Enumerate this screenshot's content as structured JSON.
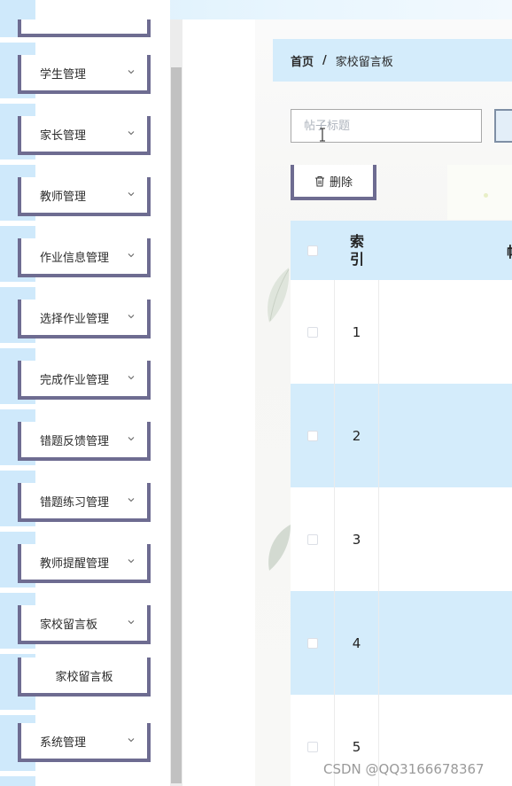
{
  "sidebar": {
    "items": [
      {
        "label": "学生管理"
      },
      {
        "label": "家长管理"
      },
      {
        "label": "教师管理"
      },
      {
        "label": "作业信息管理"
      },
      {
        "label": "选择作业管理"
      },
      {
        "label": "完成作业管理"
      },
      {
        "label": "错题反馈管理"
      },
      {
        "label": "错题练习管理"
      },
      {
        "label": "教师提醒管理"
      },
      {
        "label": "家校留言板"
      },
      {
        "label": "家校留言板"
      },
      {
        "label": "系统管理"
      }
    ]
  },
  "breadcrumb": {
    "home": "首页",
    "separator": "/",
    "current": "家校留言板"
  },
  "search": {
    "placeholder": "帖子标题",
    "value": ""
  },
  "toolbar": {
    "delete_label": "删除"
  },
  "table": {
    "columns": {
      "index": "索引",
      "title_clipped": "帖"
    },
    "rows": [
      {
        "index": "1"
      },
      {
        "index": "2"
      },
      {
        "index": "3"
      },
      {
        "index": "4"
      },
      {
        "index": "5"
      }
    ]
  },
  "watermark": "CSDN @QQ3166678367",
  "colors": {
    "accent_blue": "#d4ecfb",
    "item_border": "#6e6c91"
  }
}
